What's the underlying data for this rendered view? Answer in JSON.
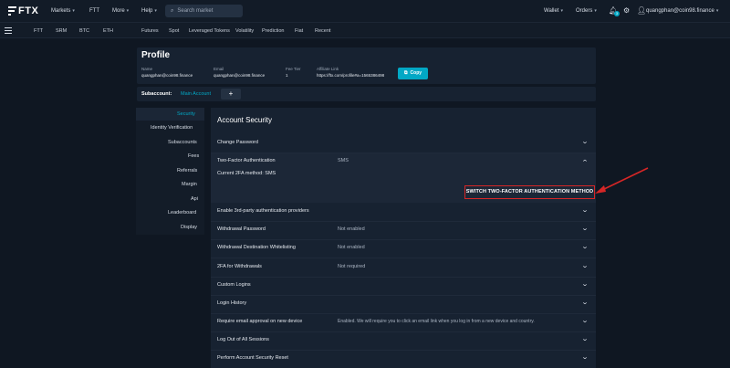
{
  "header": {
    "logo": "FTX",
    "nav": [
      {
        "label": "Markets",
        "caret": true
      },
      {
        "label": "FTT",
        "caret": false
      },
      {
        "label": "More",
        "caret": true
      },
      {
        "label": "Help",
        "caret": true
      }
    ],
    "search_placeholder": "Search market",
    "right": {
      "wallet": "Wallet",
      "orders": "Orders",
      "badge": "3",
      "email": "quangphan@coin98.finance"
    }
  },
  "subnav": {
    "items": [
      "FTT",
      "SRM",
      "BTC",
      "ETH",
      "Futures",
      "Spot",
      "Leveraged Tokens",
      "Volatility",
      "Prediction",
      "Fiat",
      "Recent"
    ]
  },
  "profile": {
    "title": "Profile",
    "fields": [
      {
        "label": "Name",
        "value": "quangphan@coin98.finance"
      },
      {
        "label": "Email",
        "value": "quangphan@coin98.finance"
      },
      {
        "label": "Fee Tier",
        "value": "1"
      },
      {
        "label": "Affiliate Link",
        "value": "https://ftx.com/profile#a=1565386498"
      }
    ],
    "copy_label": "Copy"
  },
  "subaccount": {
    "label": "Subaccount:",
    "value": "Main Account",
    "add_label": "+"
  },
  "sidebar": {
    "items": [
      "Security",
      "Identity Verification",
      "Subaccounts",
      "Fees",
      "Referrals",
      "Margin",
      "Api",
      "Leaderboard",
      "Display"
    ],
    "active": "Security"
  },
  "security": {
    "title": "Account Security",
    "rows": [
      {
        "label": "Change Password",
        "value": ""
      },
      {
        "label": "Two-Factor Authentication",
        "value": "SMS"
      },
      {
        "label": "Enable 3rd-party authentication providers",
        "value": ""
      },
      {
        "label": "Withdrawal Password",
        "value": "Not enabled"
      },
      {
        "label": "Withdrawal Destination Whitelisting",
        "value": "Not enabled"
      },
      {
        "label": "2FA for Withdrawals",
        "value": "Not required"
      },
      {
        "label": "Custom Logins",
        "value": ""
      },
      {
        "label": "Login History",
        "value": ""
      },
      {
        "label": "Require email approval on new device",
        "value": "Enabled. We will require you to click an email link when you log in from a new device and country."
      },
      {
        "label": "Log Out of All Sessions",
        "value": ""
      },
      {
        "label": "Perform Account Security Reset",
        "value": ""
      }
    ],
    "current_2fa": "Current 2FA method: SMS",
    "switch_label": "SWITCH TWO-FACTOR AUTHENTICATION METHOD"
  },
  "colors": {
    "accent": "#02a8c5",
    "highlight": "#d62626"
  }
}
